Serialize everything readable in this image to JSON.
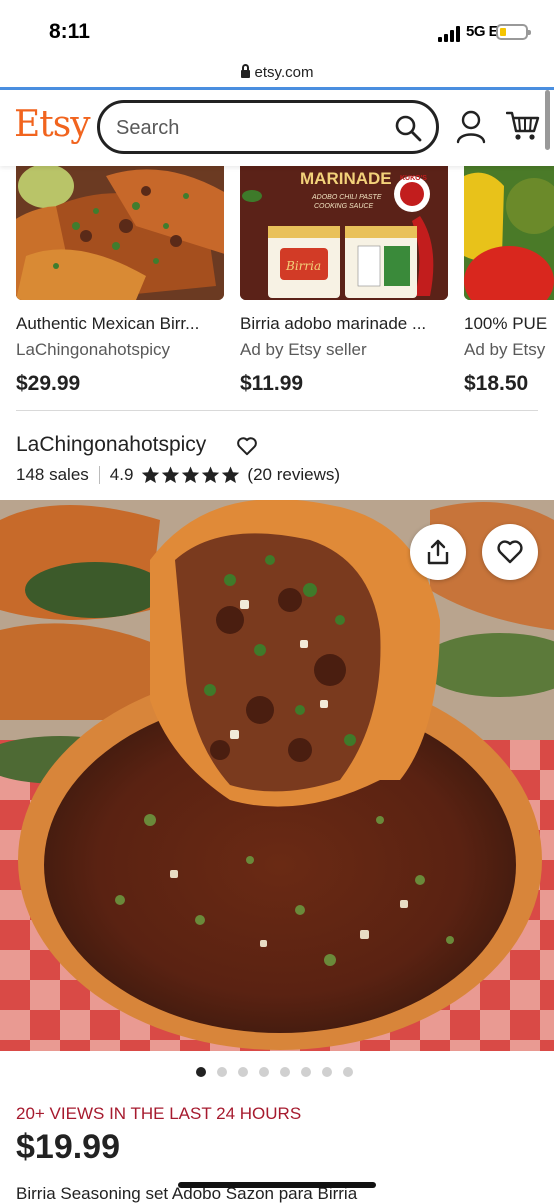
{
  "status_bar": {
    "time": "8:11",
    "network": "5G E"
  },
  "browser": {
    "url": "etsy.com"
  },
  "header": {
    "logo": "Etsy",
    "search_placeholder": "Search"
  },
  "related": [
    {
      "title": "Authentic Mexican Birr...",
      "shop": "LaChingonahotspicy",
      "price": "$29.99"
    },
    {
      "title": "Birria adobo marinade ...",
      "shop": "Ad by Etsy seller",
      "price": "$11.99",
      "img_text_1": "MARINADE",
      "img_text_2": "ADOBO CHILI PASTE",
      "img_text_3": "COOKING SAUCE",
      "img_text_4": "KUKO'S",
      "img_text_5": "Birria"
    },
    {
      "title": "100% PUE",
      "shop": "Ad by Etsy",
      "price": "$18.50"
    }
  ],
  "shop": {
    "name": "LaChingonahotspicy",
    "sales": "148 sales",
    "rating": "4.9",
    "reviews": "(20 reviews)",
    "stars": 5
  },
  "image_dots": {
    "count": 8,
    "active": 0
  },
  "listing": {
    "views": "20+ VIEWS IN THE LAST 24 HOURS",
    "price": "$19.99",
    "title": "Birria Seasoning set Adobo Sazon para Birria"
  },
  "colors": {
    "brand": "#f1641e",
    "views": "#a61a2e",
    "text": "#222222"
  }
}
